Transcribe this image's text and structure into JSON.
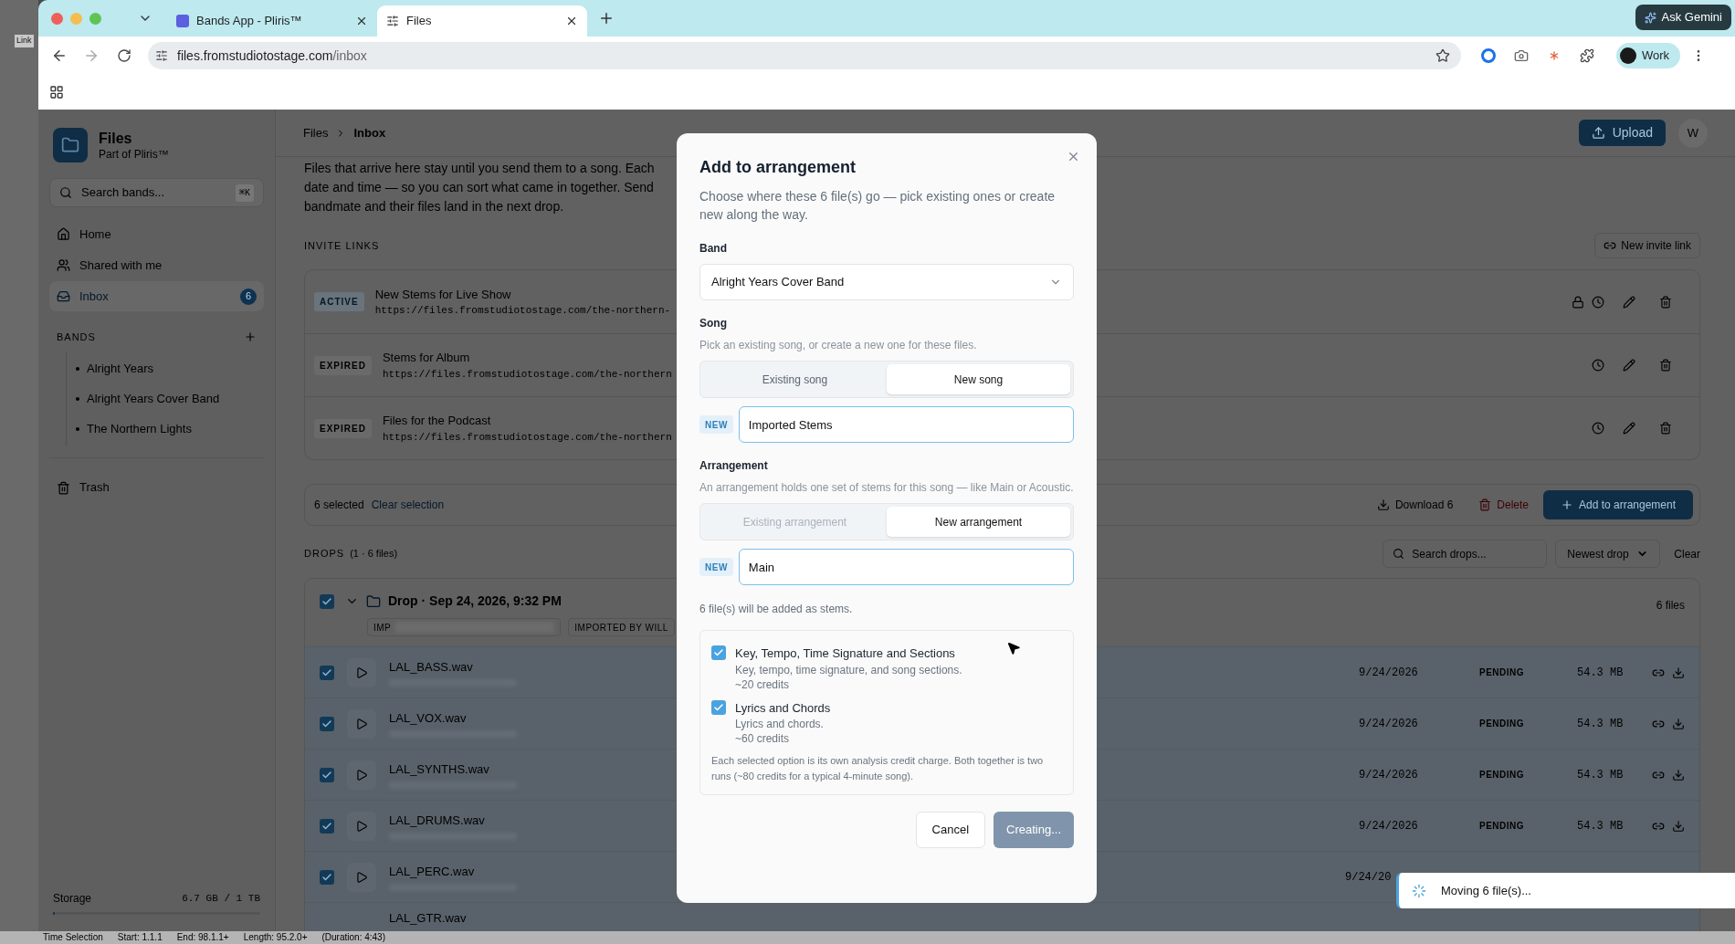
{
  "desktop": {
    "app_label": "Link",
    "status_items": [
      "Time Selection",
      "Start: 1.1.1",
      "End: 98.1.1+",
      "Length: 95.2.0+",
      "(Duration: 4:43)"
    ]
  },
  "browser": {
    "tabs": [
      {
        "title": "Bands App - Pliris™",
        "selected": false
      },
      {
        "title": "Files",
        "selected": true
      }
    ],
    "ask_button": "Ask Gemini",
    "url_host": "files.fromstudiotostage.com",
    "url_path": "/inbox",
    "profile": "Work"
  },
  "sidebar": {
    "app_name": "Files",
    "app_subtitle": "Part of Pliris™",
    "search": {
      "placeholder": "Search bands...",
      "shortcut": "⌘K"
    },
    "nav": [
      {
        "label": "Home",
        "selected": false
      },
      {
        "label": "Shared with me",
        "selected": false
      },
      {
        "label": "Inbox",
        "badge": "6",
        "selected": true
      }
    ],
    "bands_heading": "BANDS",
    "bands": [
      "Alright Years",
      "Alright Years Cover Band",
      "The Northern Lights"
    ],
    "trash": "Trash",
    "storage": {
      "label": "Storage",
      "value": "6.7 GB / 1 TB",
      "level": 0.01
    }
  },
  "header": {
    "breadcrumbs": [
      "Files",
      "Inbox"
    ],
    "upload": "Upload",
    "avatar": "W"
  },
  "intro_lines": [
    "Files that arrive here stay until you send them to a song. Each",
    "date and time — so you can sort what came in together. Send",
    "bandmate and their files land in the next drop."
  ],
  "invite_links": {
    "heading": "INVITE LINKS",
    "new_button": "New invite link",
    "rows": [
      {
        "status": "ACTIVE",
        "active": true,
        "title": "New Stems for Live Show",
        "url": "https://files.fromstudiotostage.com/the-northern-",
        "locked": true
      },
      {
        "status": "EXPIRED",
        "active": false,
        "title": "Stems for Album",
        "url": "https://files.fromstudiotostage.com/the-northern",
        "locked": false
      },
      {
        "status": "EXPIRED",
        "active": false,
        "title": "Files for the Podcast",
        "url": "https://files.fromstudiotostage.com/the-northern",
        "locked": false
      }
    ]
  },
  "selection": {
    "count": "6 selected",
    "clear": "Clear selection",
    "download": "Download 6",
    "delete": "Delete",
    "add": "Add to arrangement"
  },
  "drops": {
    "heading": "DROPS",
    "count": "(1 · 6 files)",
    "search_placeholder": "Search drops...",
    "sort": "Newest drop",
    "clear": "Clear",
    "groups": [
      {
        "title": "Drop · Sep 24, 2026, 9:32 PM",
        "checked": true,
        "expanded": true,
        "tags": [
          "IMP",
          "IMPORTED BY WILL"
        ],
        "file_count": "6 files",
        "files": [
          {
            "name": "LAL_BASS.wav",
            "checked": true,
            "date": "9/24/2026",
            "status": "PENDING",
            "size": "54.3 MB"
          },
          {
            "name": "LAL_VOX.wav",
            "checked": true,
            "date": "9/24/2026",
            "status": "PENDING",
            "size": "54.3 MB"
          },
          {
            "name": "LAL_SYNTHS.wav",
            "checked": true,
            "date": "9/24/2026",
            "status": "PENDING",
            "size": "54.3 MB"
          },
          {
            "name": "LAL_DRUMS.wav",
            "checked": true,
            "date": "9/24/2026",
            "status": "PENDING",
            "size": "54.3 MB"
          },
          {
            "name": "LAL_PERC.wav",
            "checked": true,
            "date": "9/24/20"
          },
          {
            "name": "LAL_GTR.wav"
          }
        ]
      }
    ]
  },
  "dialog": {
    "title": "Add to arrangement",
    "description": "Choose where these 6 file(s) go — pick existing ones or create new along the way.",
    "band": {
      "label": "Band",
      "value": "Alright Years Cover Band"
    },
    "song": {
      "label": "Song",
      "hint": "Pick an existing song, or create a new one for these files.",
      "options": [
        {
          "label": "Existing song",
          "selected": false,
          "disabled": false
        },
        {
          "label": "New song",
          "selected": true,
          "disabled": false
        }
      ],
      "badge": "NEW",
      "value": "Imported Stems"
    },
    "arrangement": {
      "label": "Arrangement",
      "hint": "An arrangement holds one set of stems for this song — like Main or Acoustic.",
      "options": [
        {
          "label": "Existing arrangement",
          "selected": false,
          "disabled": true
        },
        {
          "label": "New arrangement",
          "selected": true,
          "disabled": false
        }
      ],
      "badge": "NEW",
      "value": "Main"
    },
    "summary": "6 file(s) will be added as stems.",
    "analysis": [
      {
        "title": "Key, Tempo, Time Signature and Sections",
        "desc": "Key, tempo, time signature, and song sections.",
        "credits": "~20 credits",
        "checked": true
      },
      {
        "title": "Lyrics and Chords",
        "desc": "Lyrics and chords.",
        "credits": "~60 credits",
        "checked": true
      }
    ],
    "note": "Each selected option is its own analysis credit charge. Both together is two runs (~80 credits for a typical 4-minute song).",
    "cancel": "Cancel",
    "submit": {
      "label": "Creating...",
      "disabled": true
    }
  },
  "toast": {
    "message": "Moving 6 file(s)..."
  }
}
